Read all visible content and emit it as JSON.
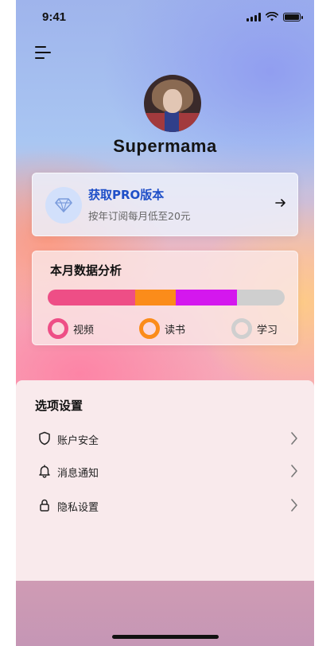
{
  "status_bar": {
    "time": "9:41"
  },
  "profile": {
    "name": "Supermama"
  },
  "pro_card": {
    "title": "获取PRO版本",
    "subtitle": "按年订阅每月低至20元",
    "accent": "#1f4fc8"
  },
  "stats": {
    "title": "本月数据分析",
    "segments": [
      {
        "label": "视频",
        "share": 0.37,
        "color": "#ee4e86"
      },
      {
        "label": "读书",
        "share": 0.17,
        "color": "#fb8c1a"
      },
      {
        "label": "学习",
        "share": 0.26,
        "color": "#d417ee",
        "ring_color": "#cfcfcf"
      }
    ],
    "remainder_color": "#cfcfcf"
  },
  "settings": {
    "title": "选项设置",
    "items": [
      {
        "label": "账户安全",
        "icon": "shield-icon"
      },
      {
        "label": "消息通知",
        "icon": "bell-icon"
      },
      {
        "label": "隐私设置",
        "icon": "lock-icon"
      }
    ]
  }
}
